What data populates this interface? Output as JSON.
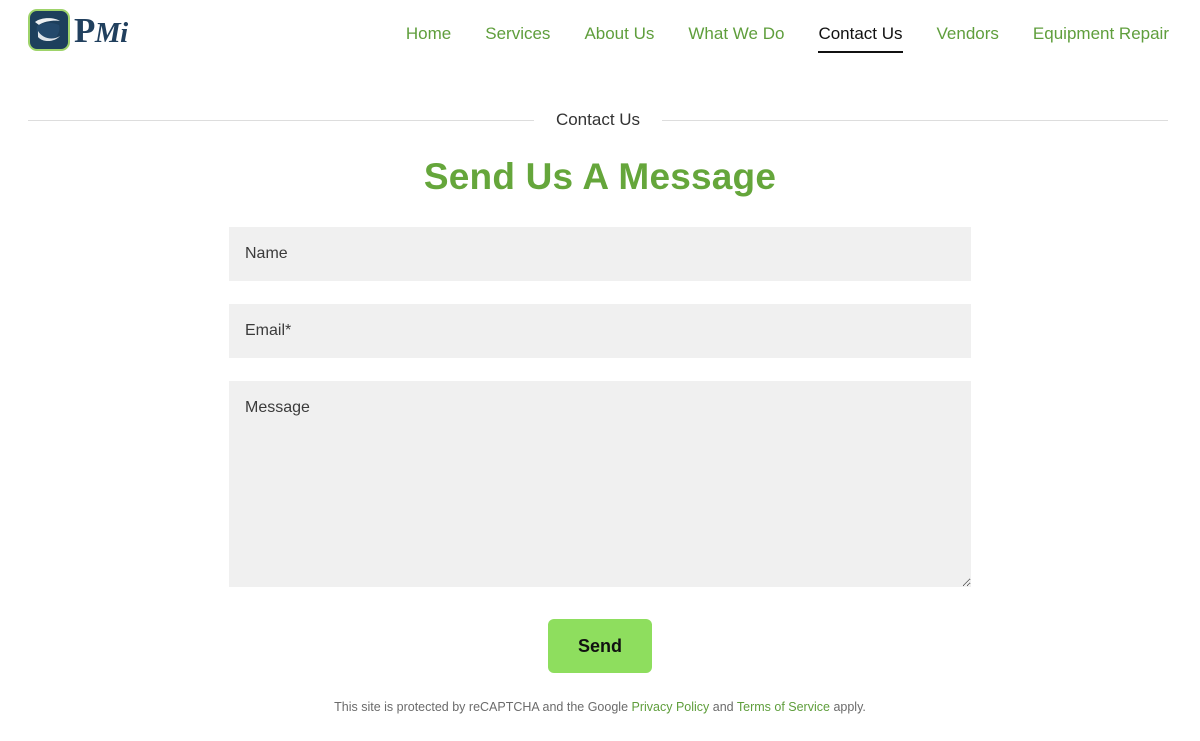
{
  "header": {
    "logo": {
      "icon": "pmi-logo-icon",
      "text_main": "P",
      "text_suffix": "Mi",
      "mark_color": "#1d3f5c",
      "mark_border_color": "#9ed36a",
      "text_color": "#21405e"
    },
    "nav": {
      "items": [
        {
          "label": "Home",
          "active": false
        },
        {
          "label": "Services",
          "active": false
        },
        {
          "label": "About Us",
          "active": false
        },
        {
          "label": "What We Do",
          "active": false
        },
        {
          "label": "Contact Us",
          "active": true
        },
        {
          "label": "Vendors",
          "active": false
        },
        {
          "label": "Equipment Repair",
          "active": false
        }
      ],
      "link_color": "#5f9e3c",
      "active_color": "#111111"
    }
  },
  "section": {
    "label": "Contact Us",
    "rule_color": "#dddddd"
  },
  "form": {
    "title": "Send Us A Message",
    "title_color": "#65a63b",
    "field_background": "#f0f0f0",
    "fields": [
      {
        "name": "name",
        "placeholder": "Name",
        "value": ""
      },
      {
        "name": "email",
        "placeholder": "Email*",
        "value": ""
      },
      {
        "name": "message",
        "placeholder": "Message",
        "value": ""
      }
    ],
    "submit": {
      "label": "Send",
      "background": "#8ede5e",
      "text_color": "#111111"
    }
  },
  "recaptcha": {
    "text_before": "This site is protected by reCAPTCHA and the Google ",
    "privacy_link": "Privacy Policy",
    "text_between": " and ",
    "terms_link": "Terms of Service",
    "text_after": " apply.",
    "link_color": "#5f9e3c"
  }
}
